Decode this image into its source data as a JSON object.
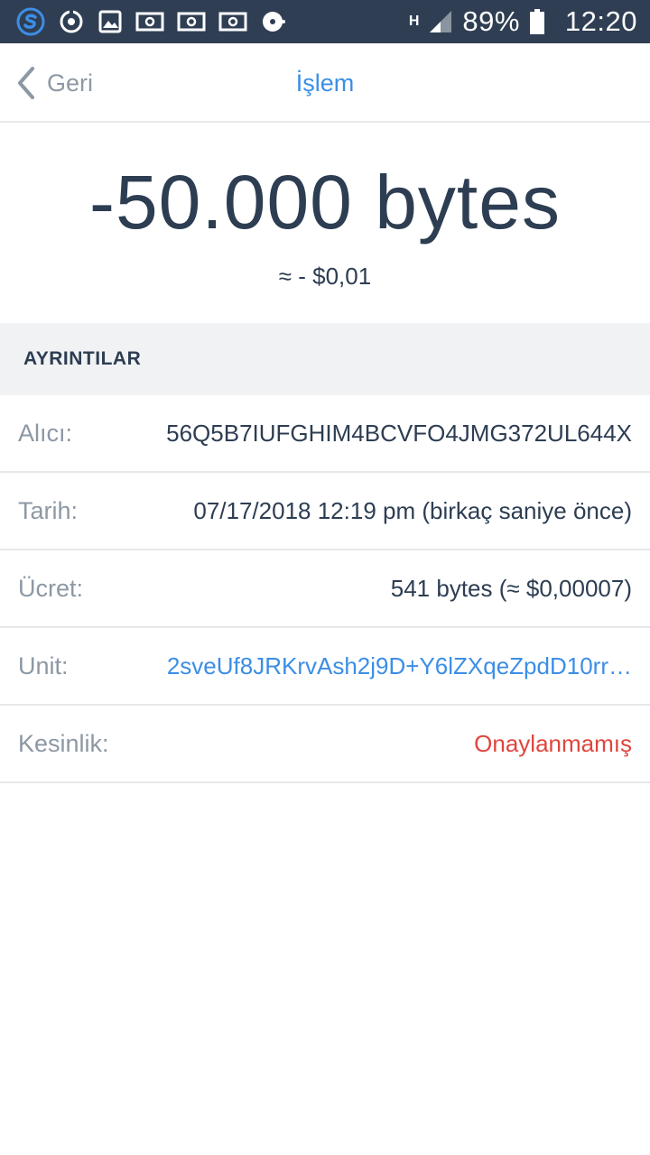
{
  "status_bar": {
    "battery_percent": "89%",
    "time": "12:20",
    "network_type": "H",
    "icons": [
      "s-logo-icon",
      "sync-icon",
      "image-icon",
      "money-icon",
      "money-icon",
      "money-icon",
      "disc-icon",
      "signal-icon",
      "battery-icon"
    ]
  },
  "nav": {
    "back_label": "Geri",
    "title": "İşlem"
  },
  "transaction": {
    "amount": "-50.000 bytes",
    "amount_fiat": "≈ - $0,01"
  },
  "details": {
    "header": "AYRINTILAR",
    "rows": [
      {
        "label": "Alıcı:",
        "value": "56Q5B7IUFGHIM4BCVFO4JMG372UL644X"
      },
      {
        "label": "Tarih:",
        "value": "07/17/2018 12:19 pm (birkaç saniye önce)"
      },
      {
        "label": "Ücret:",
        "value": "541 bytes (≈ $0,00007)"
      },
      {
        "label": "Unit:",
        "value": "2sveUf8JRKrvAsh2j9D+Y6lZXqeZpdD10rr…"
      },
      {
        "label": "Kesinlik:",
        "value": "Onaylanmamış"
      }
    ]
  },
  "colors": {
    "status_bar_bg": "#2f3e53",
    "accent": "#3c8ee6",
    "text_dark": "#2d3d52",
    "text_muted": "#8c98a4",
    "danger": "#e0453d",
    "section_bg": "#f1f2f4"
  }
}
